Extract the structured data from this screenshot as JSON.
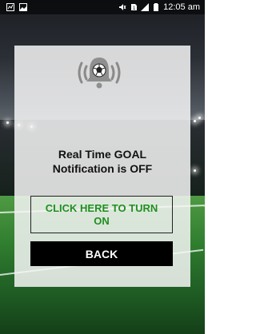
{
  "status_bar": {
    "time": "12:05 am",
    "icons": [
      "notification-icon",
      "image-icon",
      "mute-icon",
      "sim-icon",
      "signal-icon",
      "battery-icon"
    ]
  },
  "dialog": {
    "title_line1": "Real Time GOAL",
    "title_line2": "Notification is OFF",
    "turn_on_line1": "CLICK HERE TO TURN",
    "turn_on_line2": "ON",
    "back_label": "BACK",
    "icon": "ringing-bell-football-icon",
    "colors": {
      "turn_on_text": "#1f8f1f",
      "back_bg": "#000000",
      "back_text": "#ffffff"
    }
  }
}
